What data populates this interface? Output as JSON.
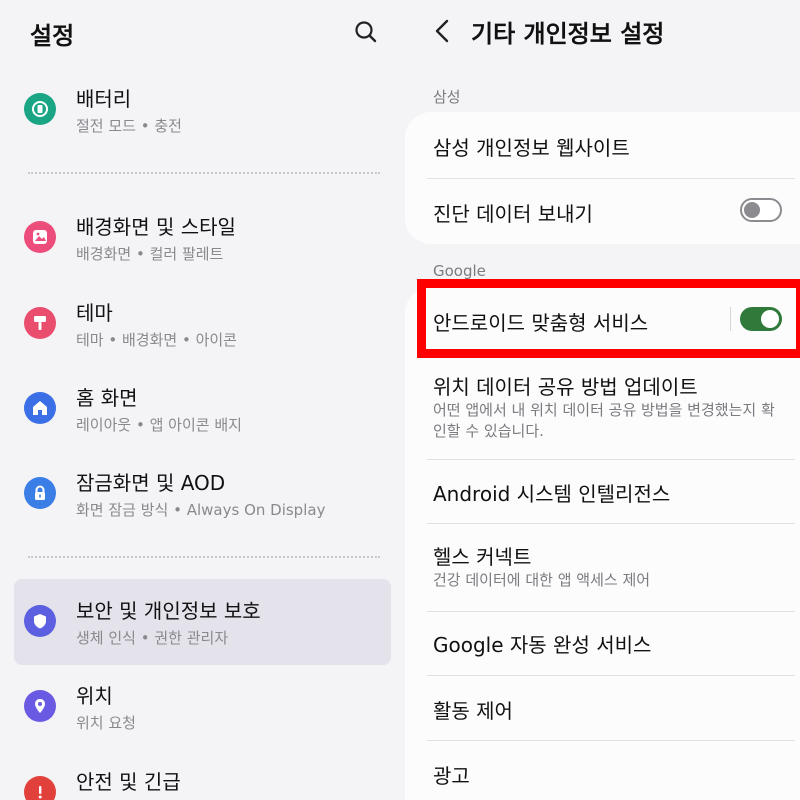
{
  "left": {
    "title": "설정",
    "search_icon": "search-icon",
    "items": [
      {
        "id": "battery",
        "title": "배터리",
        "subtitle": "절전 모드 • 충전",
        "icon": "battery-icon",
        "icon_color": "#1aa685"
      },
      {
        "id": "wallpaper",
        "title": "배경화면 및 스타일",
        "subtitle": "배경화면 • 컬러 팔레트",
        "icon": "wallpaper-icon",
        "icon_color": "#ec4d7a"
      },
      {
        "id": "theme",
        "title": "테마",
        "subtitle": "테마 • 배경화면 • 아이콘",
        "icon": "theme-icon",
        "icon_color": "#e94e6f"
      },
      {
        "id": "home",
        "title": "홈 화면",
        "subtitle": "레이아웃 • 앱 아이콘 배지",
        "icon": "home-icon",
        "icon_color": "#3a6fe6"
      },
      {
        "id": "lockscreen",
        "title": "잠금화면 및 AOD",
        "subtitle": "화면 잠금 방식 • Always On Display",
        "icon": "lock-icon",
        "icon_color": "#3a7ee6"
      },
      {
        "id": "security",
        "title": "보안 및 개인정보 보호",
        "subtitle": "생체 인식 • 권한 관리자",
        "icon": "shield-icon",
        "icon_color": "#5b5fe0",
        "active": true
      },
      {
        "id": "location",
        "title": "위치",
        "subtitle": "위치 요청",
        "icon": "location-icon",
        "icon_color": "#6a5ae3"
      },
      {
        "id": "safety",
        "title": "안전 및 긴급",
        "subtitle": "",
        "icon": "emergency-icon",
        "icon_color": "#e2413b"
      }
    ]
  },
  "right": {
    "title": "기타 개인정보 설정",
    "back_icon": "back-arrow-icon",
    "sections": {
      "samsung_label": "삼성",
      "google_label": "Google"
    },
    "samsung_rows": [
      {
        "title": "삼성 개인정보 웹사이트"
      },
      {
        "title": "진단 데이터 보내기",
        "toggle": false
      }
    ],
    "google_rows": [
      {
        "title": "안드로이드 맞춤형 서비스",
        "toggle": true
      },
      {
        "title": "위치 데이터 공유 방법 업데이트",
        "subtitle": "어떤 앱에서 내 위치 데이터 공유 방법을 변경했는지 확인할 수 있습니다."
      },
      {
        "title": "Android 시스템 인텔리전스"
      },
      {
        "title": "헬스 커넥트",
        "subtitle": "건강 데이터에 대한 앱 액세스 제어"
      },
      {
        "title": "Google 자동 완성 서비스"
      },
      {
        "title": "활동 제어"
      },
      {
        "title": "광고"
      }
    ],
    "colors": {
      "toggle_on": "#2f7a3a",
      "highlight": "#ff0000"
    }
  }
}
